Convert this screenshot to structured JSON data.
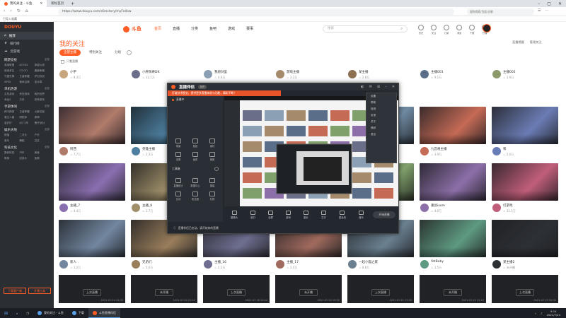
{
  "browser": {
    "tabs": [
      {
        "label": "我的关注 - 斗鱼",
        "active": true
      },
      {
        "label": "新标签页",
        "active": false
      }
    ],
    "url": "https://www.douyu.com/directory/myFollow",
    "bookmark": "已导入收藏",
    "right_hint": "搜狗搜索/百度/谷歌",
    "accent": "#ff5d23"
  },
  "sidebar": {
    "logo": "DOUYU",
    "links": [
      "推荐",
      "排行榜",
      "云游戏"
    ],
    "sections": [
      {
        "title": "网游竞技",
        "more": "全部",
        "items": [
          "英雄联盟",
          "DOTA2",
          "穿越火线",
          "绝地求生",
          "CS:GO",
          "魔兽争霸",
          "守望先锋",
          "王者荣耀",
          "炉石传说",
          "APEX",
          "使命召唤",
          "逆水寒"
        ]
      },
      {
        "title": "单机热游",
        "more": "全部",
        "items": [
          "主机游戏",
          "怀旧游戏",
          "我的世界",
          "命运2",
          "方舟",
          "恐怖游戏"
        ]
      },
      {
        "title": "手游休闲",
        "more": "全部",
        "items": [
          "和平精英",
          "王者荣耀",
          "火影忍者",
          "第五人格",
          "阴阳师",
          "原神",
          "金铲铲",
          "QQ飞车",
          "蛋仔派对"
        ]
      },
      {
        "title": "娱乐天地",
        "more": "全部",
        "items": [
          "颜值",
          "二次元",
          "户外",
          "音乐",
          "舞蹈",
          "交友"
        ]
      },
      {
        "title": "科技文化",
        "more": "全部",
        "items": [
          "数码科技",
          "汽车",
          "美食",
          "教育",
          "纪录片",
          "鱼教"
        ]
      }
    ],
    "buttons": [
      "下载客户端",
      "开播工具"
    ]
  },
  "header": {
    "logo": "斗鱼",
    "nav": [
      {
        "label": "首页",
        "active": true
      },
      {
        "label": "直播",
        "active": false
      },
      {
        "label": "分类",
        "active": false
      },
      {
        "label": "鱼吧",
        "active": false
      },
      {
        "label": "游戏",
        "active": false
      },
      {
        "label": "赛事",
        "active": false
      }
    ],
    "search_placeholder": "搜索",
    "icons": [
      "历史",
      "关注",
      "订阅",
      "消息",
      "下载",
      "开播"
    ]
  },
  "content": {
    "title": "我的关注",
    "tabs": [
      {
        "label": "全部主播",
        "active": true
      },
      {
        "label": "特别关注",
        "active": false
      },
      {
        "label": "分组",
        "active": false
      }
    ],
    "checkbox_label": "只看直播",
    "right_actions": [
      "直播提醒",
      "管理关注"
    ],
    "cards": [
      {
        "name": "小宇",
        "viewers": "8.3万",
        "live": true,
        "palette": [
          "#3b3f49",
          "#c7a57d"
        ]
      },
      {
        "name": "小胖佩奇DK",
        "viewers": "12.1万",
        "live": true,
        "palette": [
          "#1f2331",
          "#6b6e88"
        ]
      },
      {
        "name": "我想剑圣",
        "viewers": "4.6万",
        "live": true,
        "palette": [
          "#29313f",
          "#8b9fb5"
        ]
      },
      {
        "name": "游戏主播",
        "viewers": "3.2万",
        "live": true,
        "palette": [
          "#2d2b30",
          "#a58a6c"
        ]
      },
      {
        "name": "某主播",
        "viewers": "2.8万",
        "live": true,
        "palette": [
          "#3a2f2c",
          "#8d6f52"
        ]
      },
      {
        "name": "主播001",
        "viewers": "9.1万",
        "live": true,
        "palette": [
          "#1f2530",
          "#5a6e8a"
        ]
      },
      {
        "name": "主播002",
        "viewers": "1.9万",
        "live": true,
        "palette": [
          "#30332c",
          "#8c9a6b"
        ]
      },
      {
        "name": "阿西",
        "viewers": "7.7万",
        "live": true,
        "palette": [
          "#3c2d30",
          "#b07b6b"
        ]
      },
      {
        "name": "英雄主播",
        "viewers": "2.3万",
        "live": true,
        "palette": [
          "#20303a",
          "#4e7fa0"
        ]
      },
      {
        "name": "游戏解说",
        "viewers": "1.1万",
        "live": true,
        "palette": [
          "#2a2a34",
          "#7b7b9e"
        ]
      },
      {
        "name": "xxx",
        "viewers": "5.2万",
        "live": true,
        "palette": [
          "#38302a",
          "#9c8260"
        ]
      },
      {
        "name": "路人甲",
        "viewers": "6.6万",
        "live": true,
        "palette": [
          "#2b323a",
          "#6f8aa2"
        ]
      },
      {
        "name": "九宫格主播",
        "viewers": "3.9万",
        "live": true,
        "palette": [
          "#3a2b2b",
          "#c56a55"
        ]
      },
      {
        "name": "和",
        "viewers": "2.0万",
        "live": true,
        "palette": [
          "#2c2f3a",
          "#6a7cb5"
        ]
      },
      {
        "name": "主播_7",
        "viewers": "4.4万",
        "live": true,
        "palette": [
          "#2f2c38",
          "#8a6fb0"
        ]
      },
      {
        "name": "主播_8",
        "viewers": "1.7万",
        "live": true,
        "palette": [
          "#33302a",
          "#a0906a"
        ]
      },
      {
        "name": "主播_9",
        "viewers": "3.3万",
        "live": true,
        "palette": [
          "#2a3034",
          "#6e8f98"
        ]
      },
      {
        "name": "NB",
        "viewers": "6.0万",
        "live": true,
        "palette": [
          "#2a2f38",
          "#7c8fb0"
        ]
      },
      {
        "name": "主播_11",
        "viewers": "2.5万",
        "live": true,
        "palette": [
          "#2d3329",
          "#7fa06a"
        ]
      },
      {
        "name": "重创ixom",
        "viewers": "4.0万",
        "live": true,
        "palette": [
          "#2f2a36",
          "#8c6fa8"
        ]
      },
      {
        "name": "打游戏",
        "viewers": "11.5万",
        "live": true,
        "palette": [
          "#3a2830",
          "#c05e7a"
        ]
      },
      {
        "name": "新人",
        "viewers": "1.2万",
        "live": true,
        "palette": [
          "#2c3138",
          "#7286a0"
        ]
      },
      {
        "name": "兄弟们",
        "viewers": "5.6万",
        "live": true,
        "palette": [
          "#322e2a",
          "#9a7e5c"
        ]
      },
      {
        "name": "主播_16",
        "viewers": "2.2万",
        "live": true,
        "palette": [
          "#2c2c34",
          "#6e6e90"
        ]
      },
      {
        "name": "主播_17",
        "viewers": "3.0万",
        "live": true,
        "palette": [
          "#312a2a",
          "#a06a5e"
        ]
      },
      {
        "name": "一起小猫之家",
        "viewers": "8.8万",
        "live": true,
        "palette": [
          "#2a2e34",
          "#6a8090"
        ]
      },
      {
        "name": "YetBaby",
        "viewers": "1.5万",
        "live": true,
        "palette": [
          "#2a3430",
          "#5e9a82"
        ]
      },
      {
        "name": "某主播2",
        "viewers": "未开播",
        "live": false,
        "palette": [
          "#202225",
          "#2d3035"
        ]
      },
      {
        "name": "主播_20",
        "viewers": "2.1万",
        "live": true,
        "palette": [
          "#2e2c30",
          "#7a7084"
        ]
      },
      {
        "name": "主播_21",
        "viewers": "1.6万",
        "live": true,
        "palette": [
          "#2f2f2a",
          "#8c8c6a"
        ]
      }
    ],
    "bottom_row": [
      {
        "label": "上次直播",
        "date": "2021-07-24 14:03"
      },
      {
        "label": "未开播",
        "date": "2021-07-20 21:12"
      },
      {
        "label": "上次直播",
        "date": "2021-07-18 10:44"
      },
      {
        "label": "未开播",
        "date": "2021-07-22 19:30"
      },
      {
        "label": "上次直播",
        "date": "2021-07-21 17:55"
      },
      {
        "label": "未开播",
        "date": "2021-07-15 13:15"
      },
      {
        "label": "上次直播",
        "date": "2021-07-23 09:02"
      }
    ]
  },
  "overlay": {
    "title": "直播伴侣",
    "version_badge": "VIP",
    "notice": "打破技术壁垒，提供更多直播体验与功能，精彩不断！",
    "left_label": "直播中",
    "grid_top": [
      "场景",
      "贴纸",
      "素材",
      "设置",
      "画质",
      "美颜"
    ],
    "grid_mid_label": "工具箱",
    "grid_bottom": [
      "直播统计",
      "数据中心",
      "弹幕",
      "互动",
      "粉丝团",
      "礼物"
    ],
    "toolbar": [
      "摄像头",
      "窗口",
      "全屏",
      "游戏",
      "图片",
      "文字",
      "麦克风",
      "音乐"
    ],
    "status_text": "直播伴侣已启动，请开始你的直播",
    "menu": [
      "设置",
      "帮助",
      "检测",
      "反馈",
      "关于",
      "换肤",
      "退出"
    ],
    "start_button": "开始直播"
  },
  "taskbar": {
    "items": [
      {
        "label": "我的关注 - 斗鱼",
        "active": false
      },
      {
        "label": "下载",
        "active": false
      },
      {
        "label": "斗鱼直播伴侣",
        "active": true
      }
    ],
    "time": "9:14",
    "date": "2021/7/24"
  }
}
